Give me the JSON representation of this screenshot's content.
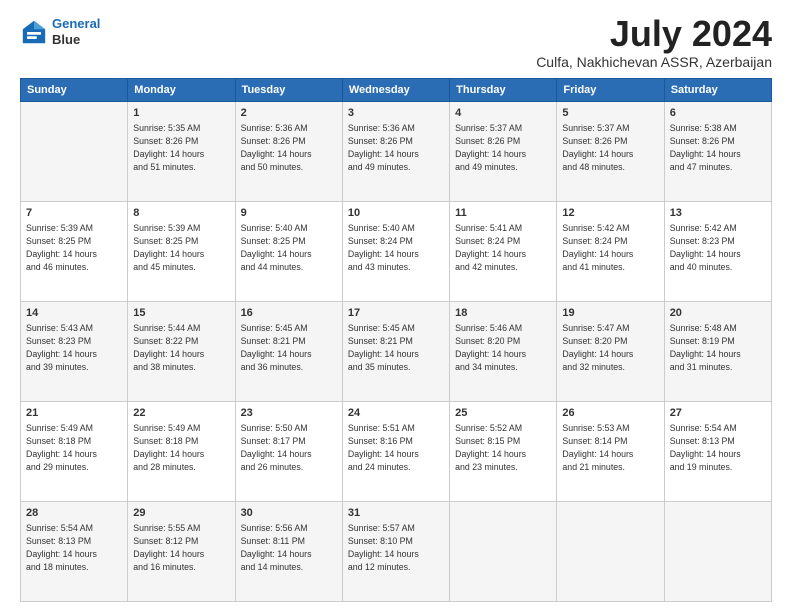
{
  "header": {
    "logo": {
      "line1": "General",
      "line2": "Blue"
    },
    "title": "July 2024",
    "location": "Culfa, Nakhichevan ASSR, Azerbaijan"
  },
  "weekdays": [
    "Sunday",
    "Monday",
    "Tuesday",
    "Wednesday",
    "Thursday",
    "Friday",
    "Saturday"
  ],
  "weeks": [
    [
      {
        "day": "",
        "info": ""
      },
      {
        "day": "1",
        "info": "Sunrise: 5:35 AM\nSunset: 8:26 PM\nDaylight: 14 hours\nand 51 minutes."
      },
      {
        "day": "2",
        "info": "Sunrise: 5:36 AM\nSunset: 8:26 PM\nDaylight: 14 hours\nand 50 minutes."
      },
      {
        "day": "3",
        "info": "Sunrise: 5:36 AM\nSunset: 8:26 PM\nDaylight: 14 hours\nand 49 minutes."
      },
      {
        "day": "4",
        "info": "Sunrise: 5:37 AM\nSunset: 8:26 PM\nDaylight: 14 hours\nand 49 minutes."
      },
      {
        "day": "5",
        "info": "Sunrise: 5:37 AM\nSunset: 8:26 PM\nDaylight: 14 hours\nand 48 minutes."
      },
      {
        "day": "6",
        "info": "Sunrise: 5:38 AM\nSunset: 8:26 PM\nDaylight: 14 hours\nand 47 minutes."
      }
    ],
    [
      {
        "day": "7",
        "info": "Sunrise: 5:39 AM\nSunset: 8:25 PM\nDaylight: 14 hours\nand 46 minutes."
      },
      {
        "day": "8",
        "info": "Sunrise: 5:39 AM\nSunset: 8:25 PM\nDaylight: 14 hours\nand 45 minutes."
      },
      {
        "day": "9",
        "info": "Sunrise: 5:40 AM\nSunset: 8:25 PM\nDaylight: 14 hours\nand 44 minutes."
      },
      {
        "day": "10",
        "info": "Sunrise: 5:40 AM\nSunset: 8:24 PM\nDaylight: 14 hours\nand 43 minutes."
      },
      {
        "day": "11",
        "info": "Sunrise: 5:41 AM\nSunset: 8:24 PM\nDaylight: 14 hours\nand 42 minutes."
      },
      {
        "day": "12",
        "info": "Sunrise: 5:42 AM\nSunset: 8:24 PM\nDaylight: 14 hours\nand 41 minutes."
      },
      {
        "day": "13",
        "info": "Sunrise: 5:42 AM\nSunset: 8:23 PM\nDaylight: 14 hours\nand 40 minutes."
      }
    ],
    [
      {
        "day": "14",
        "info": "Sunrise: 5:43 AM\nSunset: 8:23 PM\nDaylight: 14 hours\nand 39 minutes."
      },
      {
        "day": "15",
        "info": "Sunrise: 5:44 AM\nSunset: 8:22 PM\nDaylight: 14 hours\nand 38 minutes."
      },
      {
        "day": "16",
        "info": "Sunrise: 5:45 AM\nSunset: 8:21 PM\nDaylight: 14 hours\nand 36 minutes."
      },
      {
        "day": "17",
        "info": "Sunrise: 5:45 AM\nSunset: 8:21 PM\nDaylight: 14 hours\nand 35 minutes."
      },
      {
        "day": "18",
        "info": "Sunrise: 5:46 AM\nSunset: 8:20 PM\nDaylight: 14 hours\nand 34 minutes."
      },
      {
        "day": "19",
        "info": "Sunrise: 5:47 AM\nSunset: 8:20 PM\nDaylight: 14 hours\nand 32 minutes."
      },
      {
        "day": "20",
        "info": "Sunrise: 5:48 AM\nSunset: 8:19 PM\nDaylight: 14 hours\nand 31 minutes."
      }
    ],
    [
      {
        "day": "21",
        "info": "Sunrise: 5:49 AM\nSunset: 8:18 PM\nDaylight: 14 hours\nand 29 minutes."
      },
      {
        "day": "22",
        "info": "Sunrise: 5:49 AM\nSunset: 8:18 PM\nDaylight: 14 hours\nand 28 minutes."
      },
      {
        "day": "23",
        "info": "Sunrise: 5:50 AM\nSunset: 8:17 PM\nDaylight: 14 hours\nand 26 minutes."
      },
      {
        "day": "24",
        "info": "Sunrise: 5:51 AM\nSunset: 8:16 PM\nDaylight: 14 hours\nand 24 minutes."
      },
      {
        "day": "25",
        "info": "Sunrise: 5:52 AM\nSunset: 8:15 PM\nDaylight: 14 hours\nand 23 minutes."
      },
      {
        "day": "26",
        "info": "Sunrise: 5:53 AM\nSunset: 8:14 PM\nDaylight: 14 hours\nand 21 minutes."
      },
      {
        "day": "27",
        "info": "Sunrise: 5:54 AM\nSunset: 8:13 PM\nDaylight: 14 hours\nand 19 minutes."
      }
    ],
    [
      {
        "day": "28",
        "info": "Sunrise: 5:54 AM\nSunset: 8:13 PM\nDaylight: 14 hours\nand 18 minutes."
      },
      {
        "day": "29",
        "info": "Sunrise: 5:55 AM\nSunset: 8:12 PM\nDaylight: 14 hours\nand 16 minutes."
      },
      {
        "day": "30",
        "info": "Sunrise: 5:56 AM\nSunset: 8:11 PM\nDaylight: 14 hours\nand 14 minutes."
      },
      {
        "day": "31",
        "info": "Sunrise: 5:57 AM\nSunset: 8:10 PM\nDaylight: 14 hours\nand 12 minutes."
      },
      {
        "day": "",
        "info": ""
      },
      {
        "day": "",
        "info": ""
      },
      {
        "day": "",
        "info": ""
      }
    ]
  ]
}
